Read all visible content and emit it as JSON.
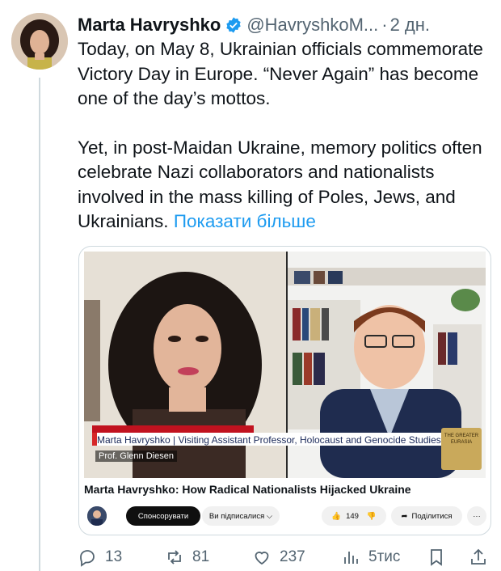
{
  "tweet": {
    "author_name": "Marta Havryshko",
    "handle": "@HavryshkoM...",
    "separator": "·",
    "time": "2 дн.",
    "paragraph_1": "Today, on May 8, Ukrainian officials commemorate Victory Day in Europe. “Never Again” has become one of the day’s mottos.",
    "paragraph_2": "Yet, in post-Maidan Ukraine, memory politics often celebrate Nazi collaborators and nationalists involved in the mass killing of Poles, Jews, and Ukrainians.",
    "show_more": "Показати більше"
  },
  "video_card": {
    "lower_third_title": "Marta Havryshko | Visiting Assistant Professor, Holocaust and Genocide Studies",
    "lower_third_sub": "Prof. Glenn Diesen",
    "badge_text": "THE GREATER EURASIA",
    "title": "Marta Havryshko: How Radical Nationalists Hijacked Ukraine",
    "sponsor_label": "Спонсорувати",
    "subscribed_label": "Ви підписалися ⌵",
    "like_count": "149",
    "share_label": "Поділитися",
    "more_label": "···"
  },
  "actions": {
    "replies": "13",
    "reposts": "81",
    "likes": "237",
    "views": "5тис"
  },
  "colors": {
    "link": "#1d9bf0",
    "muted": "#536471",
    "verified": "#1d9bf0"
  }
}
